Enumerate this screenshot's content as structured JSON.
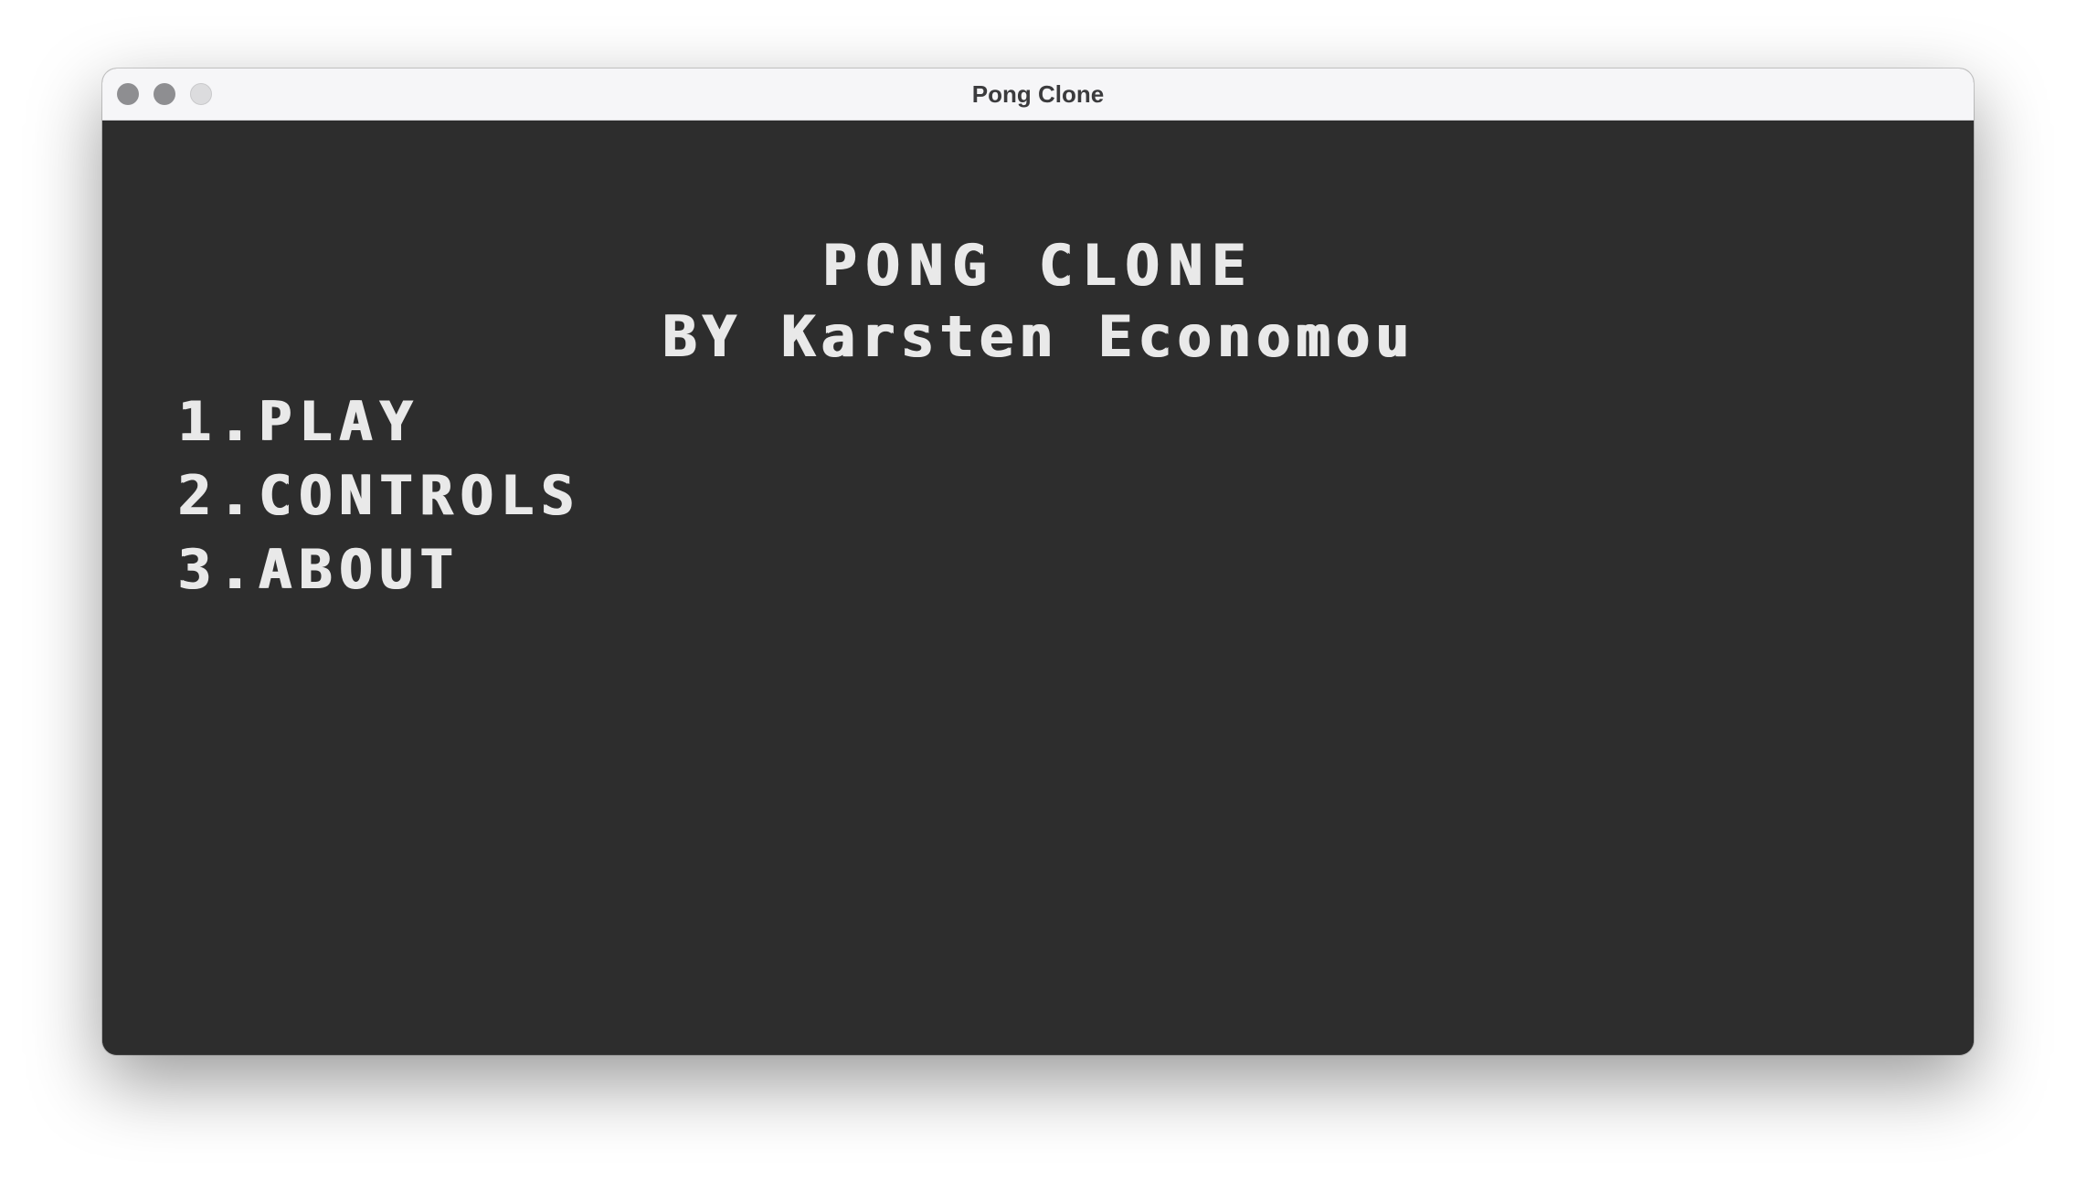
{
  "window": {
    "title": "Pong Clone"
  },
  "game": {
    "title": "PONG CLONE",
    "author": "BY Karsten Economou",
    "menu": [
      {
        "number": "1.",
        "label": "PLAY"
      },
      {
        "number": "2.",
        "label": "CONTROLS"
      },
      {
        "number": "3.",
        "label": "ABOUT"
      }
    ]
  },
  "colors": {
    "background": "#2d2d2d",
    "text": "#e9e9e9",
    "titlebar": "#f6f6f8"
  }
}
